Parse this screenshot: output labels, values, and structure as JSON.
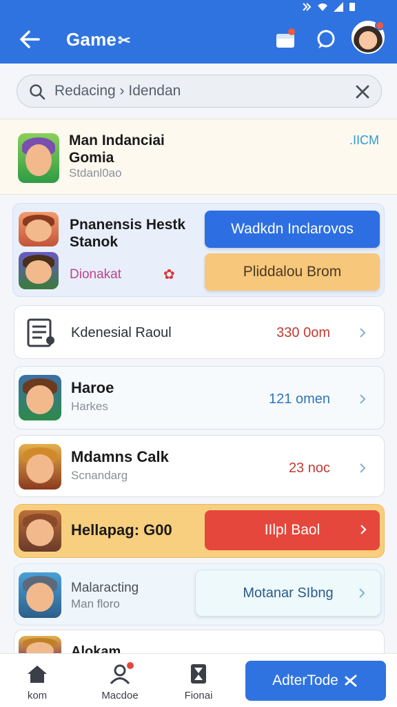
{
  "app": {
    "title": "Game",
    "title_glyph": "✂",
    "accent": "#2f73e0"
  },
  "search": {
    "value": "Redacing › Idendan",
    "icon": "search-icon",
    "clear_icon": "close-icon"
  },
  "featured": {
    "title": "Man Indanciai Gomia",
    "subtitle": "Stdanl0ao",
    "badge": ".IICM"
  },
  "promo": {
    "title": "Pnanensis Hestk Stanok",
    "subtitle": "Dionakat",
    "primary_button": "Wadkdn Inclarovos",
    "secondary_button": "Pliddalou Brom"
  },
  "rows": [
    {
      "title": "Kdenesial Raoul",
      "value": "330 0om",
      "value_color": "#c43a30"
    },
    {
      "title": "Haroe",
      "subtitle": "Harkes",
      "value": "121 omen",
      "value_color": "#2f73b8"
    },
    {
      "title": "Mdamns Calk",
      "subtitle": "Scnandarg",
      "value": "23 noc",
      "value_color": "#c43a30"
    },
    {
      "title": "Hellapag: G00",
      "button": "IIlpl Baol"
    },
    {
      "title": "Malaracting",
      "subtitle": "Man floro",
      "button": "Motanar SIbng"
    },
    {
      "title": "Alokam"
    }
  ],
  "bottom_nav": {
    "tabs": [
      {
        "label": "kom",
        "icon": "home-icon"
      },
      {
        "label": "Macdoe",
        "icon": "person-icon"
      },
      {
        "label": "Fionai",
        "icon": "hourglass-icon"
      }
    ],
    "action_button": "AdterTode"
  }
}
